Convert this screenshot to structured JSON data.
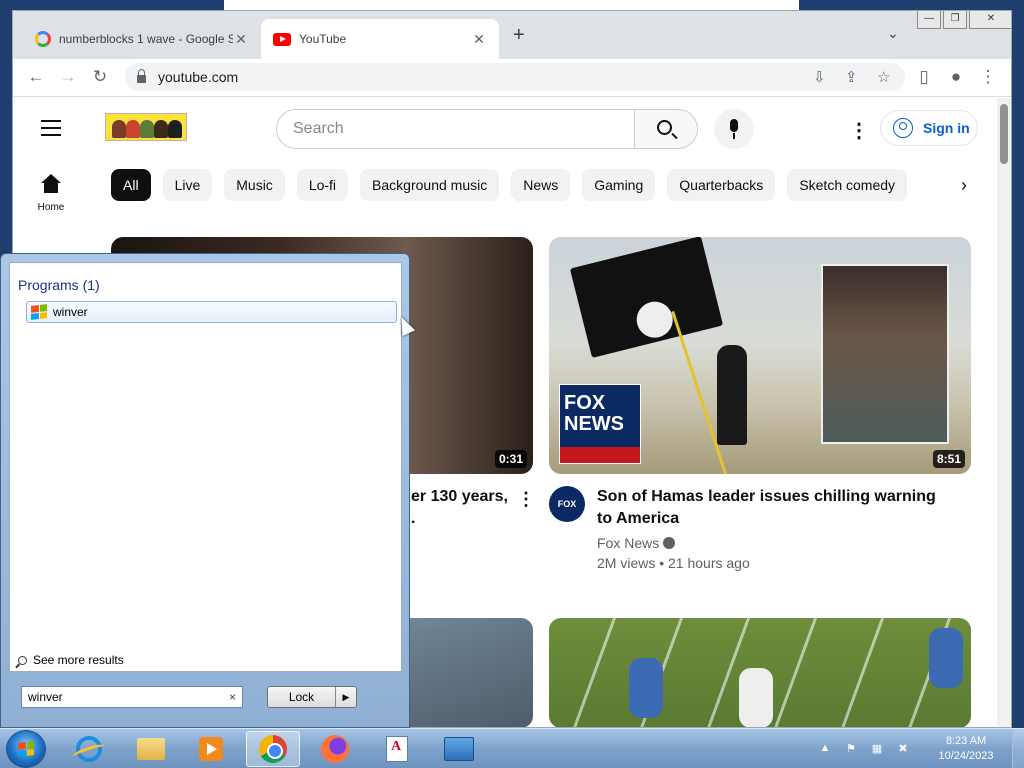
{
  "browser": {
    "tabs": [
      {
        "title": "numberblocks 1 wave - Google S",
        "icon": "google-icon",
        "active": false
      },
      {
        "title": "YouTube",
        "icon": "youtube-icon",
        "active": true
      }
    ],
    "new_tab_label": "+",
    "url": "youtube.com",
    "window_controls": {
      "minimize": "—",
      "restore": "❐",
      "close": "✕"
    }
  },
  "youtube": {
    "search_placeholder": "Search",
    "sign_in_label": "Sign in",
    "sidebar": {
      "home_label": "Home"
    },
    "chips": [
      "All",
      "Live",
      "Music",
      "Lo-fi",
      "Background music",
      "News",
      "Gaming",
      "Quarterbacks",
      "Sketch comedy"
    ],
    "videos": [
      {
        "title_partial": "er 130 years,",
        "title_line2": ".",
        "duration": "0:31"
      },
      {
        "title": "Son of Hamas leader issues chilling warning to America",
        "channel": "Fox News",
        "meta": "2M views • 21 hours ago",
        "duration": "8:51",
        "thumbnail_logo": "FOX NEWS",
        "avatar_text": "FOX NEWS"
      }
    ]
  },
  "start_menu": {
    "programs_heading": "Programs (1)",
    "results": [
      {
        "label": "winver",
        "icon": "windows-icon"
      }
    ],
    "see_more_label": "See more results",
    "search_value": "winver",
    "clear_label": "×",
    "power_button_label": "Lock",
    "power_arrow": "▶"
  },
  "taskbar": {
    "apps": [
      "internet-explorer",
      "windows-explorer",
      "media-player",
      "chrome",
      "firefox",
      "wordpad",
      "control-panel"
    ],
    "clock_time": "8:23 AM",
    "clock_date": "10/24/2023",
    "tray_show_hidden": "▲"
  },
  "colors": {
    "yt_red": "#ff0000",
    "yt_blue": "#065fd4",
    "taskbar": "#7ea3cb",
    "start_menu": "#a9c8e6"
  }
}
